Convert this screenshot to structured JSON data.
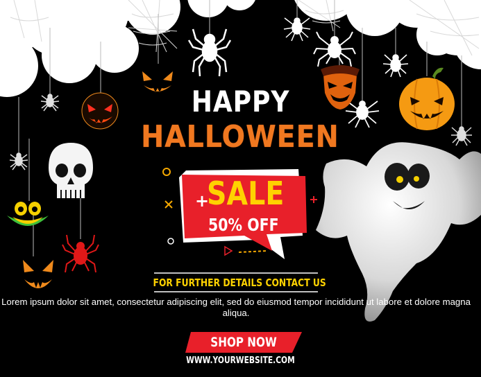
{
  "poster": {
    "happy": "HAPPY",
    "halloween": "HALLOWEEN",
    "sale": "SALE",
    "sale_prefix": "+",
    "discount": "50% OFF",
    "contact": "FOR FURTHER DETAILS CONTACT US",
    "body_text": "Lorem ipsum dolor sit amet, consectetur adipiscing elit, sed do eiusmod tempor incididunt ut labore et dolore magna aliqua.",
    "shop_button": "SHOP NOW",
    "website": "WWW.YOURWEBSITE.COM"
  },
  "colors": {
    "background": "#000000",
    "accent_orange": "#f07820",
    "sale_red": "#e8202a",
    "sale_yellow": "#ffd200",
    "text_white": "#ffffff"
  },
  "icons": [
    "spider-web-icon",
    "cloud-icon",
    "spider-icon",
    "jack-o-lantern-icon",
    "skull-icon",
    "ghost-icon",
    "demon-mask-icon"
  ]
}
